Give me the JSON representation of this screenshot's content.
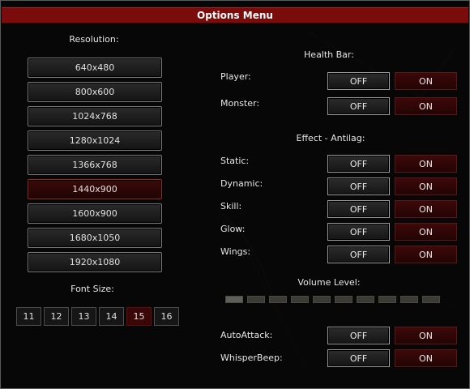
{
  "window": {
    "title": "Options Menu"
  },
  "resolution": {
    "label": "Resolution:",
    "options": [
      "640x480",
      "800x600",
      "1024x768",
      "1280x1024",
      "1366x768",
      "1440x900",
      "1600x900",
      "1680x1050",
      "1920x1080"
    ],
    "selected": "1440x900"
  },
  "font_size": {
    "label": "Font Size:",
    "options": [
      "11",
      "12",
      "13",
      "14",
      "15",
      "16"
    ],
    "selected": "15"
  },
  "health_bar": {
    "label": "Health Bar:",
    "rows": [
      {
        "label": "Player:",
        "off": "OFF",
        "on": "ON",
        "state": "OFF"
      },
      {
        "label": "Monster:",
        "off": "OFF",
        "on": "ON",
        "state": "OFF"
      }
    ]
  },
  "effect_antilag": {
    "label": "Effect - Antilag:",
    "rows": [
      {
        "label": "Static:",
        "off": "OFF",
        "on": "ON",
        "state": "OFF"
      },
      {
        "label": "Dynamic:",
        "off": "OFF",
        "on": "ON",
        "state": "OFF"
      },
      {
        "label": "Skill:",
        "off": "OFF",
        "on": "ON",
        "state": "OFF"
      },
      {
        "label": "Glow:",
        "off": "OFF",
        "on": "ON",
        "state": "OFF"
      },
      {
        "label": "Wings:",
        "off": "OFF",
        "on": "ON",
        "state": "OFF"
      }
    ]
  },
  "volume": {
    "label": "Volume Level:",
    "segments": 10,
    "level": 1
  },
  "misc": {
    "rows": [
      {
        "label": "AutoAttack:",
        "off": "OFF",
        "on": "ON",
        "state": "OFF"
      },
      {
        "label": "WhisperBeep:",
        "off": "OFF",
        "on": "ON",
        "state": "OFF"
      }
    ]
  },
  "colors": {
    "title_bar": "#7a0c0c",
    "active_red": "#3a0606",
    "panel_bg": "#0a0a0a"
  }
}
